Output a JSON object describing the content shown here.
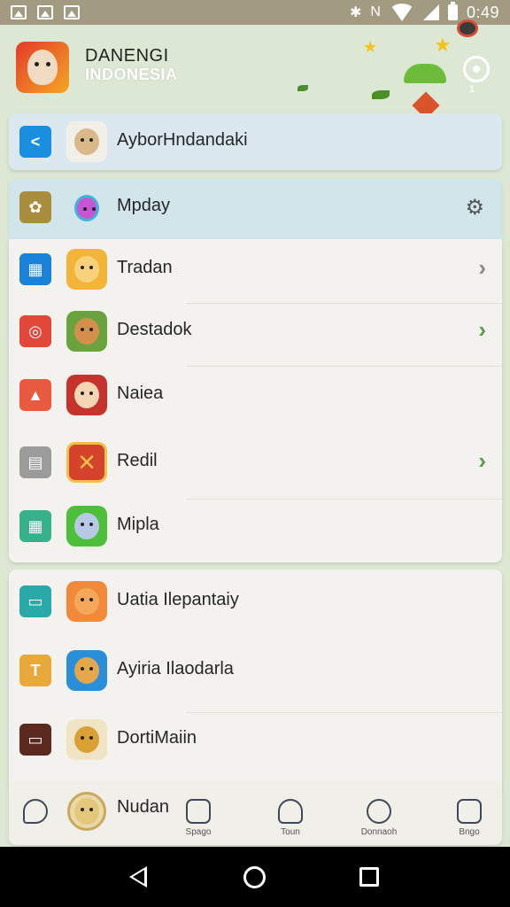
{
  "status_bar": {
    "time": "0:49",
    "nfc": "N",
    "icons": [
      "image-icon",
      "image-icon",
      "image-icon",
      "vibrate-icon",
      "nfc-icon",
      "wifi-icon",
      "signal-icon",
      "battery-icon"
    ]
  },
  "header": {
    "app_name": "DANENGI",
    "app_sub": "INDONESIA",
    "location_count": "1"
  },
  "highlight_item": {
    "label": "AyborHndandaki",
    "icon": "back-arrow-icon",
    "color": "#1a8fe0"
  },
  "mpday_item": {
    "label": "Mpday",
    "icon": "flower-icon",
    "color": "#a98e3e"
  },
  "main_list": [
    {
      "label": "Tradan",
      "icon": "calendar-icon",
      "color": "#1a82d8",
      "avatar": "#f3b43a",
      "chevron": true
    },
    {
      "label": "Destadok",
      "icon": "target-icon",
      "color": "#e2483a",
      "avatar": "#6aa23d",
      "chevron": true
    },
    {
      "label": "Naiea",
      "icon": "triangle-icon",
      "color": "#ea5a3f",
      "avatar": "#c7332c",
      "chevron": false
    },
    {
      "label": "Redil",
      "icon": "document-icon",
      "color": "#9b9b9b",
      "avatar": "#d6432c",
      "chevron": true
    },
    {
      "label": "Mipla",
      "icon": "grid-icon",
      "color": "#37b08c",
      "avatar": "#4dbf3a",
      "chevron": false
    }
  ],
  "second_list": [
    {
      "label": "Uatia Ilepantaiy",
      "icon": "calendar-icon",
      "color": "#2aa9a9",
      "avatar": "#f08a3a"
    },
    {
      "label": "Ayiria Ilaodarla",
      "icon": "document-icon",
      "color": "#e8a93a",
      "avatar": "#2a8fd8"
    },
    {
      "label": "DortiMaiin",
      "icon": "window-icon",
      "color": "#5a2a20",
      "avatar": "#d9a035"
    }
  ],
  "bottom_bar": {
    "current_label": "Nudan",
    "tabs": [
      {
        "label": "Spago",
        "icon": "chat-icon"
      },
      {
        "label": "Toun",
        "icon": "user-icon"
      },
      {
        "label": "Donnaoh",
        "icon": "block-icon"
      },
      {
        "label": "Bngo",
        "icon": "profile-icon"
      }
    ]
  }
}
